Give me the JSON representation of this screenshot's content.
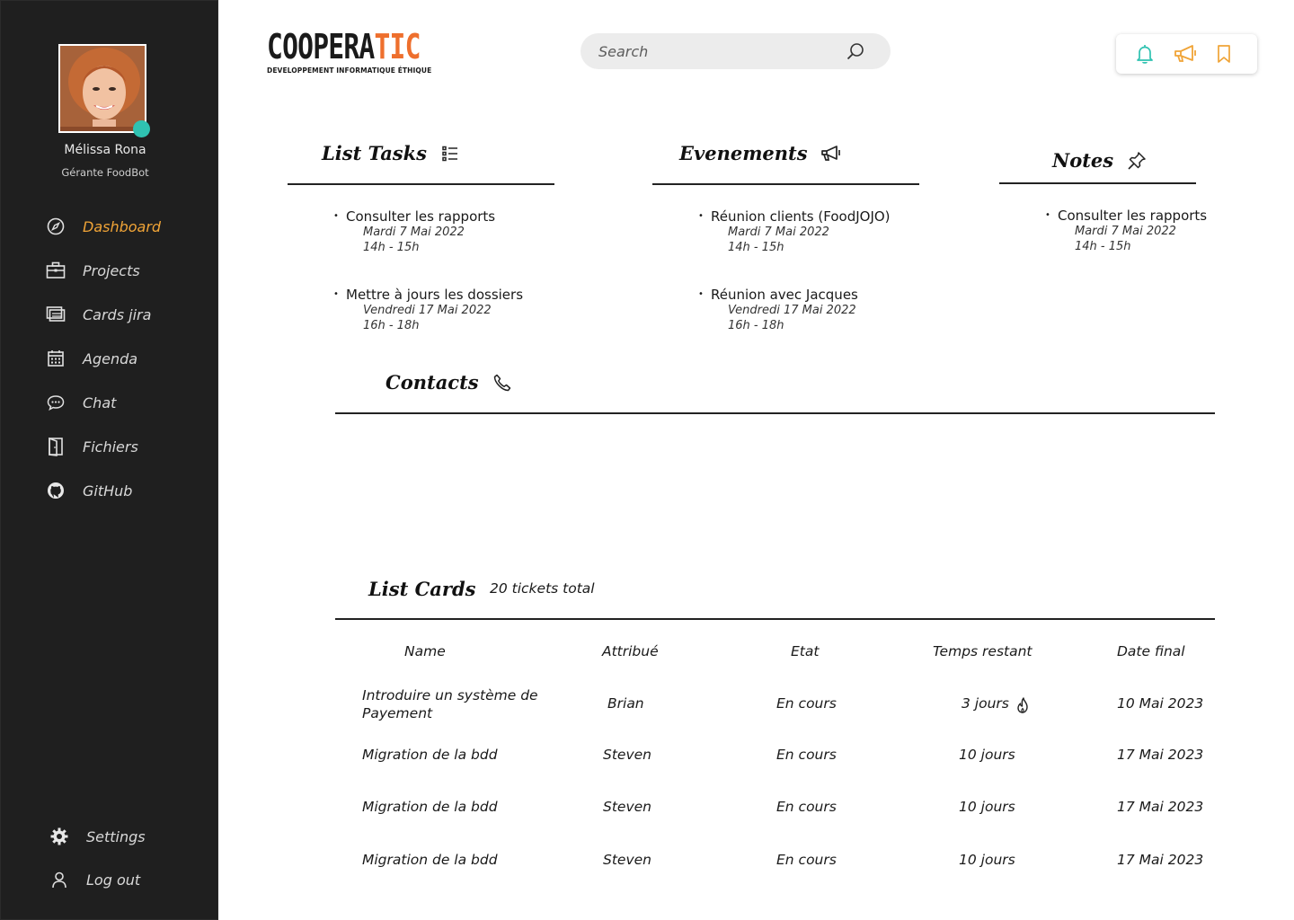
{
  "user": {
    "name": "Mélissa Rona",
    "role": "Gérante FoodBot",
    "status_color": "#2fc2b1"
  },
  "sidebar": {
    "items": [
      {
        "label": "Dashboard",
        "icon": "compass-icon",
        "active": true
      },
      {
        "label": "Projects",
        "icon": "briefcase-icon"
      },
      {
        "label": "Cards jira",
        "icon": "cards-icon"
      },
      {
        "label": "Agenda",
        "icon": "calendar-icon"
      },
      {
        "label": "Chat",
        "icon": "chat-icon"
      },
      {
        "label": "Fichiers",
        "icon": "door-icon"
      },
      {
        "label": "GitHub",
        "icon": "github-icon"
      }
    ],
    "bottom": [
      {
        "label": "Settings",
        "icon": "gear-icon"
      },
      {
        "label": "Log out",
        "icon": "user-icon"
      }
    ],
    "active_color": "#f0a437"
  },
  "logo": {
    "part1": "COOPERA",
    "part2": "TIC",
    "tagline": "DEVELOPPEMENT INFORMATIQUE ÉTHIQUE",
    "accent_color": "#ee6f2d"
  },
  "search": {
    "placeholder": "Search",
    "icon": "search-icon"
  },
  "actions": {
    "icons": [
      "bell-icon",
      "megaphone-icon",
      "bookmark-icon"
    ],
    "colors": [
      "#2fc2b1",
      "#f0a437",
      "#f0a437"
    ]
  },
  "tasks": {
    "title": "List Tasks",
    "items": [
      {
        "title": "Consulter les rapports",
        "date": "Mardi 7 Mai 2022",
        "time": "14h - 15h"
      },
      {
        "title": "Mettre à jours les dossiers",
        "date": "Vendredi 17 Mai 2022",
        "time": "16h - 18h"
      }
    ]
  },
  "events": {
    "title": "Evenements",
    "items": [
      {
        "title": "Réunion clients (FoodJOJO)",
        "date": "Mardi 7 Mai 2022",
        "time": "14h - 15h"
      },
      {
        "title": "Réunion avec Jacques",
        "date": "Vendredi 17 Mai 2022",
        "time": "16h - 18h"
      }
    ]
  },
  "notes": {
    "title": "Notes",
    "items": [
      {
        "title": "Consulter les rapports",
        "date": "Mardi 7 Mai 2022",
        "time": "14h - 15h"
      }
    ]
  },
  "contacts": {
    "title": "Contacts"
  },
  "cards": {
    "title": "List Cards",
    "total": "20 tickets total",
    "headers": [
      "Name",
      "Attribué",
      "Etat",
      "Temps restant",
      "Date final"
    ],
    "rows": [
      {
        "name": "Introduire un système de Payement",
        "assignee": "Brian",
        "state": "En cours",
        "remaining": "3 jours",
        "urgent": true,
        "due": "10 Mai 2023"
      },
      {
        "name": "Migration de la bdd",
        "assignee": "Steven",
        "state": "En cours",
        "remaining": "10 jours",
        "due": "17 Mai 2023"
      },
      {
        "name": "Migration de la bdd",
        "assignee": "Steven",
        "state": "En cours",
        "remaining": "10 jours",
        "due": "17 Mai 2023"
      },
      {
        "name": "Migration de la bdd",
        "assignee": "Steven",
        "state": "En cours",
        "remaining": "10 jours",
        "due": "17 Mai 2023"
      }
    ]
  }
}
